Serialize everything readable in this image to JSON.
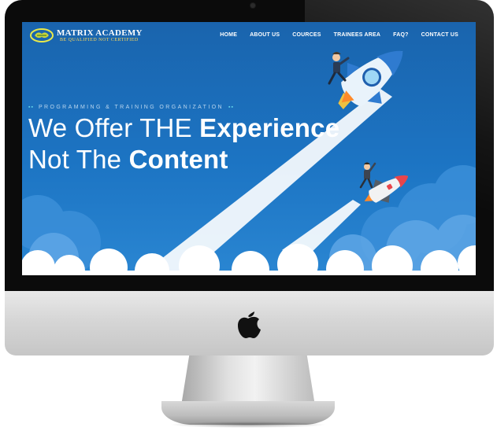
{
  "site": {
    "brand_name": "MATRIX ACADEMY",
    "brand_tagline": "BE QUALIFIED NOT CERTIFIED"
  },
  "nav": {
    "items": [
      {
        "label": "HOME"
      },
      {
        "label": "ABOUT US"
      },
      {
        "label": "COURCES"
      },
      {
        "label": "TRAINEES AREA"
      },
      {
        "label": "FAQ?"
      },
      {
        "label": "CONTACT US"
      }
    ]
  },
  "hero": {
    "eyebrow_dots_left": "▪▪",
    "eyebrow": "PROGRAMMING & TRAINING ORGANIZATION",
    "eyebrow_dots_right": "▪▪",
    "line1_light": "We Offer THE ",
    "line1_bold": "Experience",
    "line2_light": "Not The ",
    "line2_bold": "Content"
  },
  "icons": {
    "logo": "brain-logo-icon",
    "device_logo": "apple-logo-icon",
    "illustration_main": "rocket-rider-large",
    "illustration_small": "rocket-rider-small"
  },
  "colors": {
    "screen_bg": "#1c74c3",
    "accent_cyan": "#62d3ea",
    "tagline_yellow": "#ffd95a",
    "rocket_red": "#e8454b"
  }
}
